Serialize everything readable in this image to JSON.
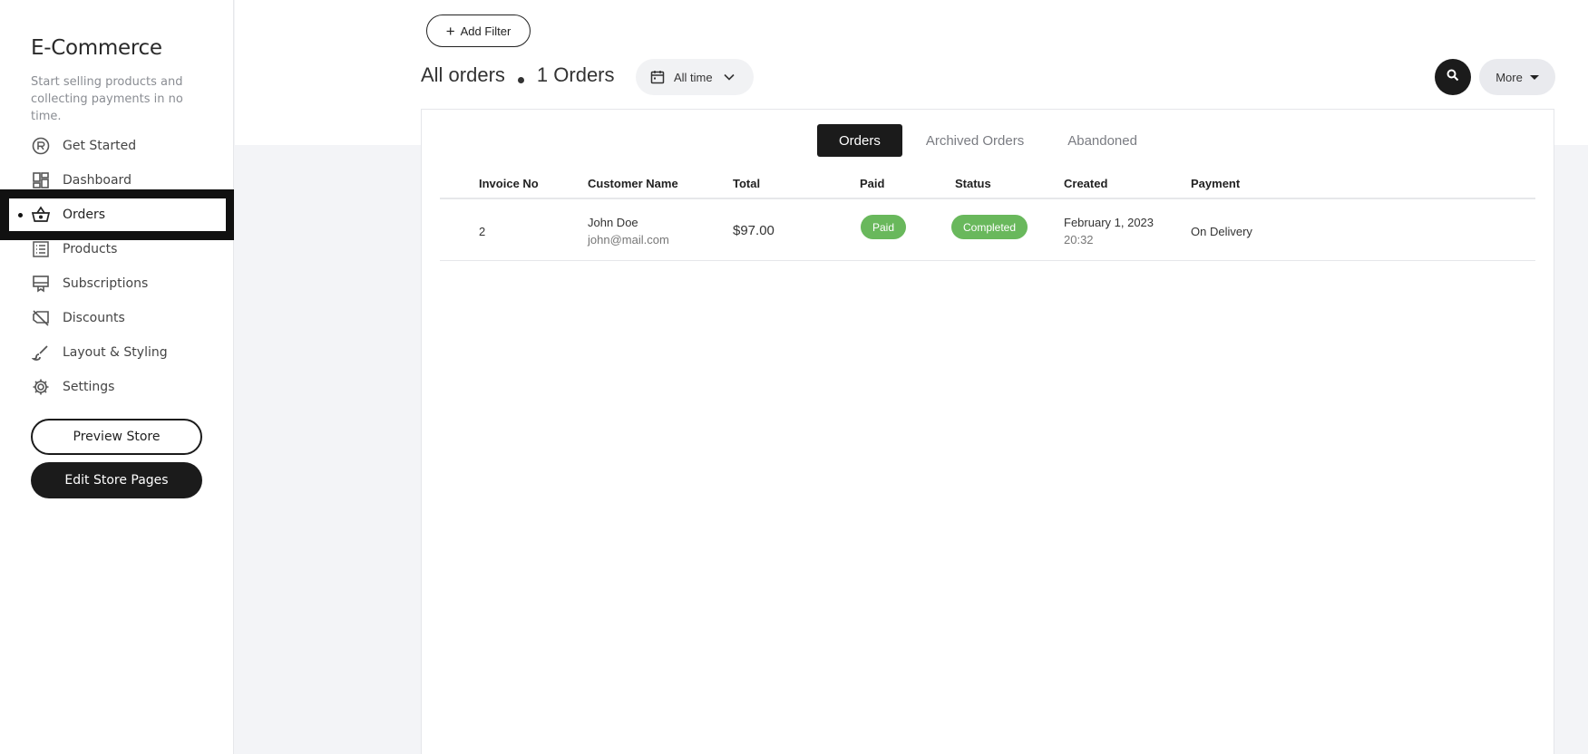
{
  "sidebar": {
    "title": "E-Commerce",
    "subtitle": "Start selling products and collecting payments in no time.",
    "items": [
      {
        "label": "Get Started",
        "icon": "rocket-badge-icon"
      },
      {
        "label": "Dashboard",
        "icon": "dashboard-icon"
      },
      {
        "label": "Orders",
        "icon": "basket-icon",
        "active": true
      },
      {
        "label": "Products",
        "icon": "list-icon"
      },
      {
        "label": "Subscriptions",
        "icon": "subscription-icon"
      },
      {
        "label": "Discounts",
        "icon": "discount-tag-icon"
      },
      {
        "label": "Layout & Styling",
        "icon": "brush-icon"
      },
      {
        "label": "Settings",
        "icon": "gear-icon"
      }
    ],
    "preview_label": "Preview Store",
    "edit_label": "Edit Store Pages"
  },
  "header": {
    "add_filter_label": "Add Filter",
    "title": "All orders",
    "count": "1 Orders",
    "range_label": "All time",
    "more_label": "More"
  },
  "tabs": [
    {
      "label": "Orders",
      "active": true
    },
    {
      "label": "Archived Orders"
    },
    {
      "label": "Abandoned"
    }
  ],
  "table": {
    "columns": [
      "Invoice No",
      "Customer Name",
      "Total",
      "Paid",
      "Status",
      "Created",
      "Payment"
    ],
    "rows": [
      {
        "invoice": "2",
        "customer_name": "John Doe",
        "customer_email": "john@mail.com",
        "total": "$97.00",
        "paid": "Paid",
        "status": "Completed",
        "created_date": "February 1, 2023",
        "created_time": "20:32",
        "payment": "On Delivery"
      }
    ]
  },
  "colors": {
    "accent": "#1b1b1b",
    "badge_green": "#69b85c"
  }
}
